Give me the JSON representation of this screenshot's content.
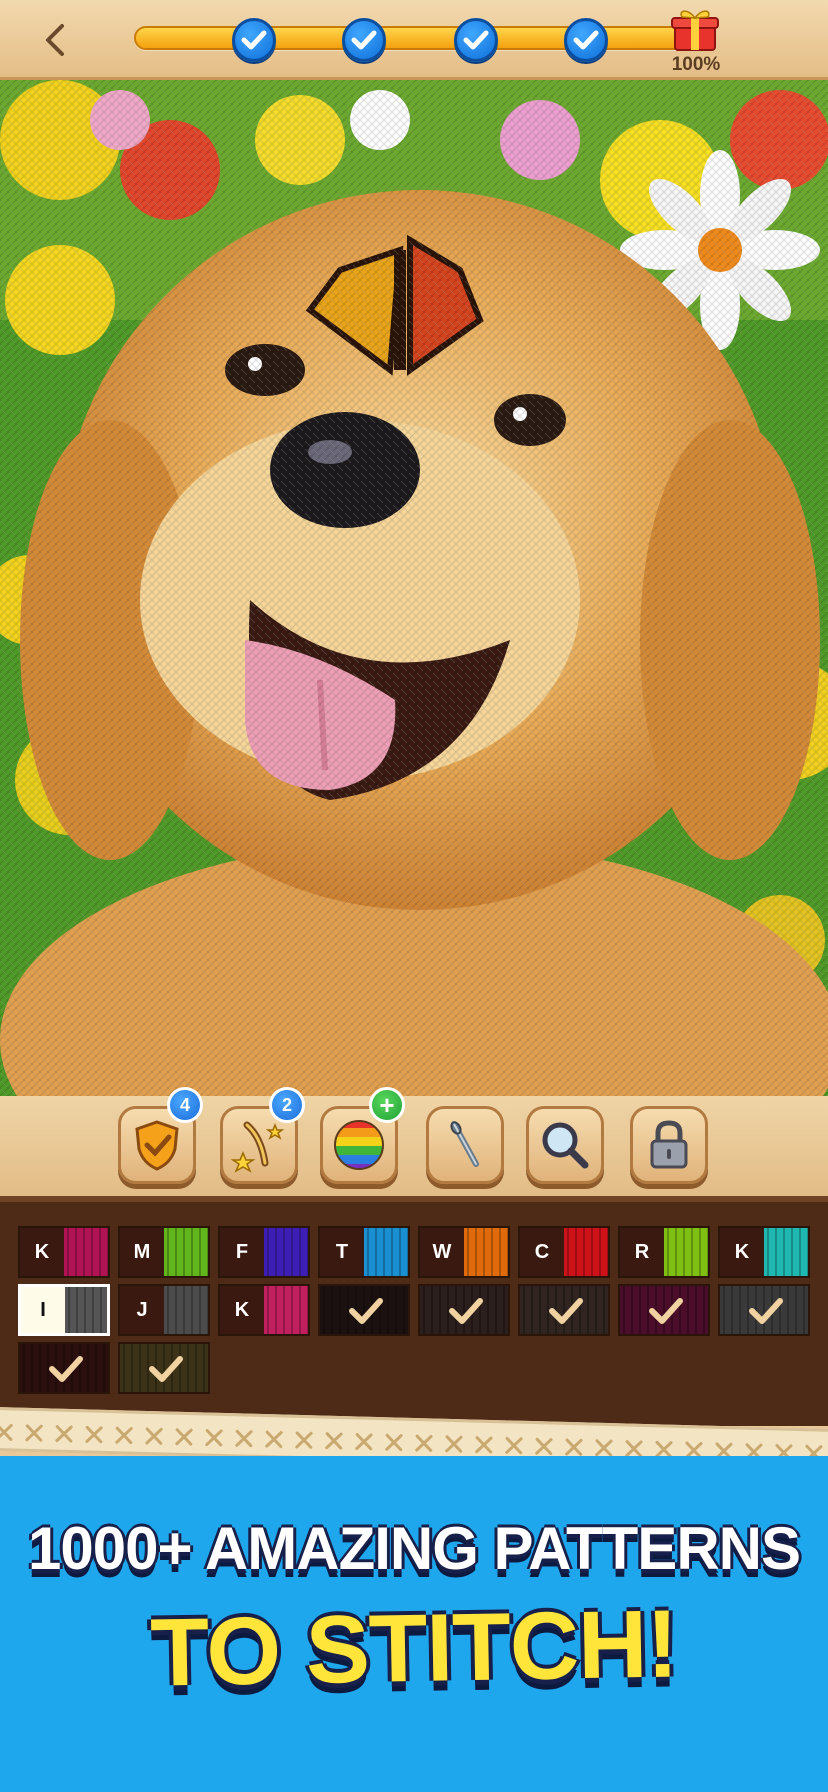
{
  "progress": {
    "percent_label": "100%",
    "fraction": 1.0,
    "checkpoints_completed": 4
  },
  "tools": [
    {
      "name": "shield",
      "badge": "4"
    },
    {
      "name": "magic-wand",
      "badge": "2"
    },
    {
      "name": "color-ball",
      "badge": "+"
    },
    {
      "name": "needle"
    },
    {
      "name": "magnifier"
    },
    {
      "name": "lock"
    }
  ],
  "palette": {
    "swatches": [
      {
        "code": "K",
        "color": "#b01455",
        "done": false
      },
      {
        "code": "M",
        "color": "#63b51c",
        "done": false
      },
      {
        "code": "F",
        "color": "#3d1fb5",
        "done": false
      },
      {
        "code": "T",
        "color": "#1a8fd1",
        "done": false
      },
      {
        "code": "W",
        "color": "#e06a0a",
        "done": false
      },
      {
        "code": "C",
        "color": "#cf1119",
        "done": false
      },
      {
        "code": "R",
        "color": "#7fbf12",
        "done": false
      },
      {
        "code": "K",
        "color": "#1fb8b0",
        "done": false
      },
      {
        "code": "I",
        "color": "#555555",
        "done": false,
        "selected": true
      },
      {
        "code": "J",
        "color": "#4c4c4c",
        "done": false
      },
      {
        "code": "K",
        "color": "#c21f5f",
        "done": false
      },
      {
        "code": "",
        "color": "#1b1110",
        "done": true
      },
      {
        "code": "",
        "color": "#2a1f1c",
        "done": true
      },
      {
        "code": "",
        "color": "#2f2420",
        "done": true
      },
      {
        "code": "",
        "color": "#4a0e2a",
        "done": true
      },
      {
        "code": "",
        "color": "#3a3a3a",
        "done": true
      },
      {
        "code": "",
        "color": "#2b0f0f",
        "done": true
      },
      {
        "code": "",
        "color": "#3b3218",
        "done": true
      }
    ]
  },
  "banner": {
    "line1": "1000+ AMAZING PATTERNS",
    "line2": "TO STITCH!"
  },
  "colors": {
    "progress_fill": "#f5a00f",
    "checkpoint": "#1a7fe6",
    "banner_bg": "#1fa7ee",
    "headline2": "#ffe43a"
  }
}
